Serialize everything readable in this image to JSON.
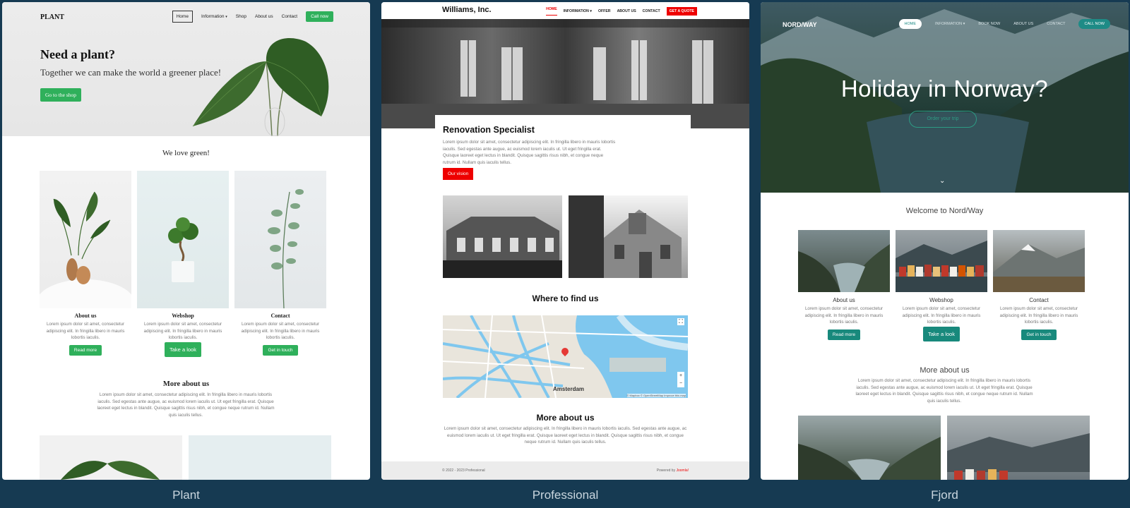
{
  "templates": [
    {
      "caption": "Plant",
      "logo": "PLANT",
      "nav": [
        "Home",
        "Information",
        "Shop",
        "About us",
        "Contact"
      ],
      "call": "Call now",
      "hero_title": "Need a plant?",
      "hero_sub": "Together we can make the world a greener place!",
      "hero_btn": "Go to the shop",
      "section1": "We love green!",
      "cols": [
        {
          "title": "About us",
          "btn": "Read more"
        },
        {
          "title": "Webshop",
          "btn": "Take a look"
        },
        {
          "title": "Contact",
          "btn": "Get in touch"
        }
      ],
      "col_text": "Lorem ipsum dolor sit amet, consectetur adipiscing elit. In fringilla libero in mauris lobortis iaculis.",
      "section2": "More about us",
      "more_text": "Lorem ipsum dolor sit amet, consectetur adipiscing elit. In fringilla libero in mauris lobortis iaculis. Sed egestas ante augue, ac euismod lorem iaculis ut. Ut eget fringilla erat. Quisque laoreet eget lectus in blandit. Quisque sagittis risus nibh, et congue neque rutrum id. Nullam quis iaculis tellus."
    },
    {
      "caption": "Professional",
      "logo": "Williams, Inc.",
      "nav": [
        "HOME",
        "INFORMATION",
        "OFFER",
        "ABOUT US",
        "CONTACT"
      ],
      "call": "GET A QUOTE",
      "hero_title": "Renovation Specialist",
      "hero_text": "Lorem ipsum dolor sit amet, consectetur adipiscing elit. In fringilla libero in mauris lobortis iaculis. Sed egestas ante augue, ac euismod lorem iaculis ut. Ut eget fringilla erat. Quisque laoreet eget lectus in blandit. Quisque sagittis risus nibh, et congue neque rutrum id. Nullam quis iaculis tellus.",
      "hero_btn": "Our vision",
      "section1": "Where to find us",
      "map_city": "Amsterdam",
      "map_attrib": "© Mapbox © OpenStreetMap  Improve this map",
      "section2": "More about us",
      "more_text": "Lorem ipsum dolor sit amet, consectetur adipiscing elit. In fringilla libero in mauris lobortis iaculis. Sed egestas ante augue, ac euismod lorem iaculis ut. Ut eget fringilla erat. Quisque laoreet eget lectus in blandit. Quisque sagittis risus nibh, et congue neque rutrum id. Nullam quis iaculis tellus.",
      "footer_left": "© 2022 - 2023 Professional",
      "footer_right_label": "Powered by",
      "footer_right_brand": "Joomla!"
    },
    {
      "caption": "Fjord",
      "logo": "NORD/WAY",
      "nav": [
        "HOME",
        "INFORMATION",
        "BOOK NOW",
        "ABOUT US",
        "CONTACT"
      ],
      "call": "CALL NOW",
      "hero_title": "Holiday in Norway?",
      "hero_btn": "Order your trip",
      "section1": "Welcome to Nord/Way",
      "cols": [
        {
          "title": "About us",
          "btn": "Read more"
        },
        {
          "title": "Webshop",
          "btn": "Take a look"
        },
        {
          "title": "Contact",
          "btn": "Get in touch"
        }
      ],
      "col_text": "Lorem ipsum dolor sit amet, consectetur adipiscing elit. In fringilla libero in mauris lobortis iaculis.",
      "section2": "More about us",
      "more_text": "Lorem ipsum dolor sit amet, consectetur adipiscing elit. In fringilla libero in mauris lobortis iaculis. Sed egestas ante augue, ac euismod lorem iaculis ut. Ut eget fringilla erat. Quisque laoreet eget lectus in blandit. Quisque sagittis risus nibh, et congue neque rutrum id. Nullam quis iaculis tellus."
    }
  ],
  "icons": {
    "dropdown": "chevron-down-icon",
    "map_pin": "map-pin-icon",
    "fullscreen": "fullscreen-icon",
    "scroll_down": "chevron-down-icon"
  },
  "colors": {
    "background": "#163a52",
    "plant_green": "#2fb05b",
    "pro_red": "#e00000",
    "fjord_teal": "#18897c"
  }
}
